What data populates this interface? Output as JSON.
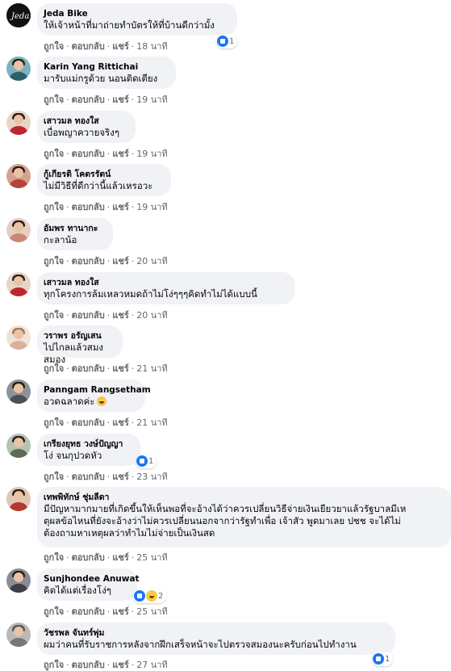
{
  "meta": {
    "like": "ถูกใจ",
    "reply": "ตอบกลับ",
    "share": "แชร์",
    "dot": "·"
  },
  "comments": [
    {
      "author": "Jeda Bike",
      "text": "ให้เจ้าหน้าที่มาถ่ายทำบัตรให้ที่บ้านดีกว่ามั้ง",
      "time": "18 นาที",
      "reactions": "1",
      "avatar_color": "#111111"
    },
    {
      "author": "Karin Yang Rittichai",
      "text": "มารับแม่กรูด้วย นอนติดเตียง",
      "time": "19 นาที",
      "avatar_color": "#5a8a96"
    },
    {
      "author": "เสาวมล ทองใส",
      "text": "เบื่อพญาควายจริงๆ",
      "time": "19 นาที",
      "avatar_color": "#c0262d"
    },
    {
      "author": "กู้เกียรติ โคตรรัตน์",
      "text": "ไม่มีวิธีที่ดีกว่านี้แล้วเหรอวะ",
      "time": "19 นาที",
      "avatar_color": "#b8433a"
    },
    {
      "author": "อัมพร ทานากะ",
      "text": "กะลาน้อ",
      "time": "20 นาที",
      "avatar_color": "#c78a73"
    },
    {
      "author": "เสาวมล ทองใส",
      "text": "ทุกโครงการล้มเหลวหมดถ้าไม่โง่ๆๆๆคิดทำไม่ได้แบบนี้",
      "time": "20 นาที",
      "avatar_color": "#c0262d"
    },
    {
      "author": "วราพร อรัญเสน",
      "text": "ไปไกลแล้วสมงสมอง",
      "time": "21 นาที",
      "avatar_color": "#d8b29a"
    },
    {
      "author": "Panngam Rangsetham",
      "text": "อวดฉลาดค่ะ",
      "time": "21 นาที",
      "avatar_color": "#6b6f78"
    },
    {
      "author": "เกรียงยุทธ วงษ์ปัญญา",
      "text": "โง่ จนกุปวดหัว",
      "time": "23 นาที",
      "reactions": "1",
      "avatar_color": "#7f8f7a"
    },
    {
      "author": "เทพพิทักษ์ ชุ่มลีดา",
      "text": "มีปัญหามากมายที่เกิดขึ้นให้เห็นพอที่จะอ้างได้ว่าควรเปลี่ยนวิธีจ่ายเงินเยียวยาแล้วรัฐบาลมีเหตุผลข้อไหนที่ยังจะอ้างว่าไม่ควรเปลี่ยนนอกจากว่ารัฐทำเพื่อ เจ้าสัว พูดมาเลย ปชช จะได้ไม่ต้องถามหาเหตุผลว่าทำไมไม่จ่ายเป็นเงินสด",
      "text_lines": [
        "มีปัญหามากมายที่เกิดขึ้นให้เห็นพอที่จะอ้างได้ว่าควรเปลี่ยนวิธีจ่ายเงินเยียวยาแล้วรัฐบาลมีเห",
        "ตุผลข้อไหนที่ยังจะอ้างว่าไม่ควรเปลี่ยนนอกจากว่ารัฐทำเพื่อ เจ้าสัว พูดมาเลย ปชช จะได้ไม่",
        "ต้องถามหาเหตุผลว่าทำไมไม่จ่ายเป็นเงินสด"
      ],
      "time": "25 นาที",
      "avatar_color": "#b23a2c"
    },
    {
      "author": "Sunjhondee Anuwat",
      "text": "คิดได้แต่เรื่องโง่ๆ",
      "time": "25 นาที",
      "reactions": "2",
      "avatar_color": "#4b4b55"
    },
    {
      "author": "วัชรพล จันทร์พุ่ม",
      "text": "ผมว่าคนที่รับราชการหลังจากฝึกเสร็จหน้าจะไปตรวจสมองนะครับก่อนไปทำงาน",
      "time": "27 นาที",
      "reactions": "1",
      "avatar_color": "#9a9a9a"
    }
  ]
}
